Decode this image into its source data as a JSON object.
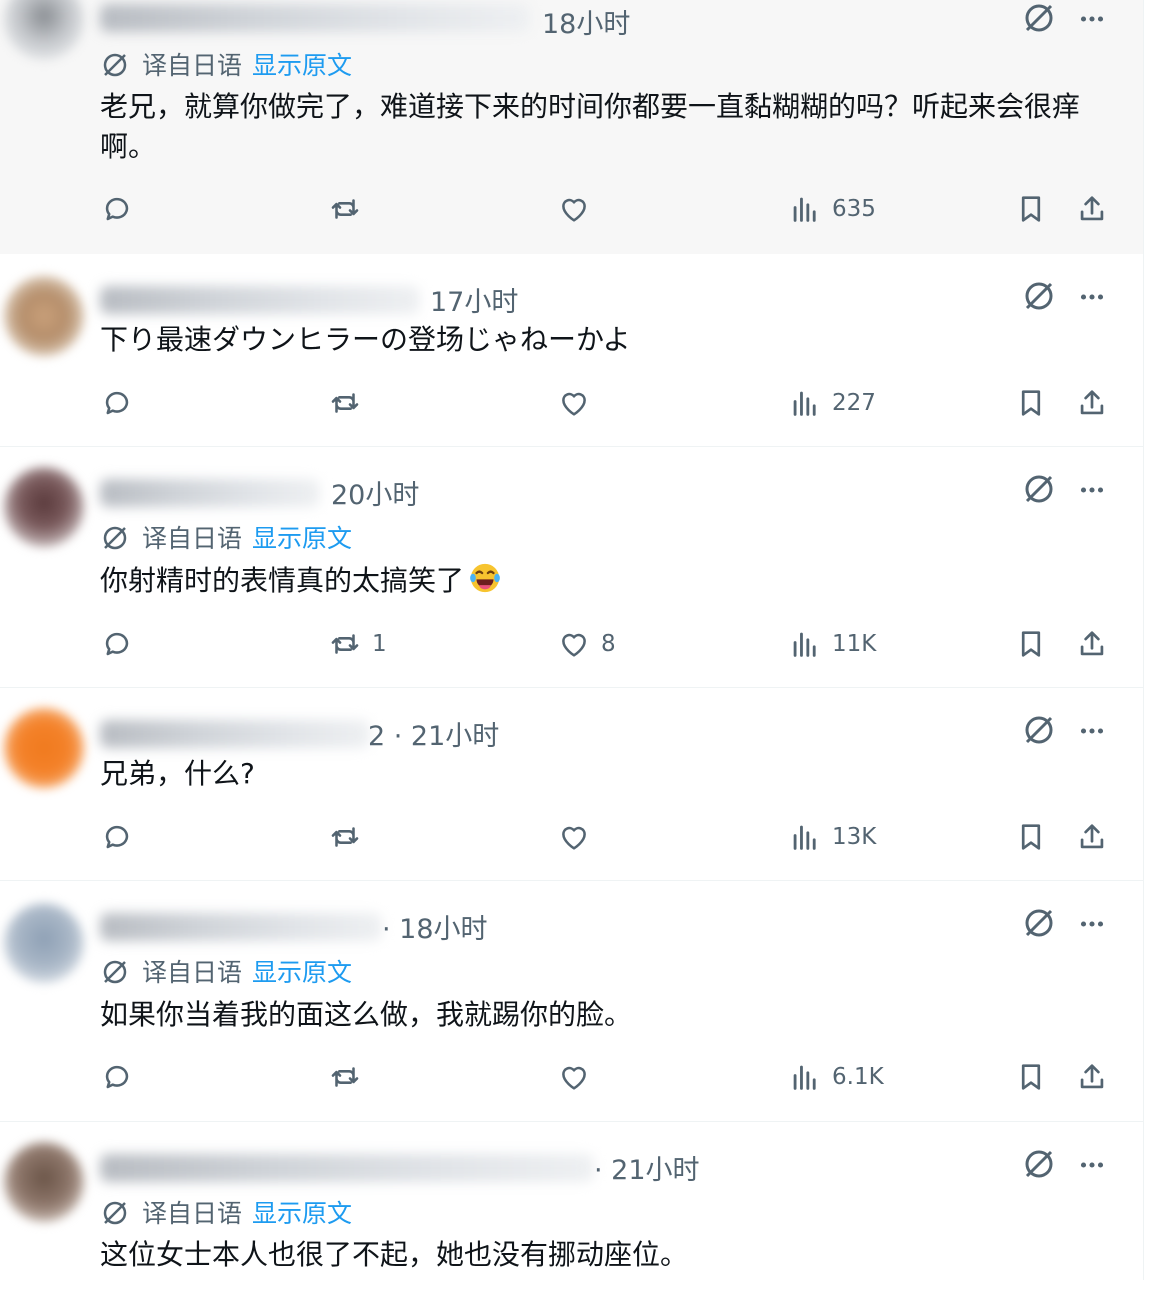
{
  "icons": {
    "reply": "reply-bubble-icon",
    "retweet": "retweet-icon",
    "like": "heart-icon",
    "views": "views-chart-icon",
    "bookmark": "bookmark-icon",
    "share": "share-upload-icon",
    "grok": "grok-slash-circle-icon",
    "more": "more-dots-icon",
    "translate": "translate-icon"
  },
  "colors": {
    "text": "#0f1419",
    "muted": "#536471",
    "link": "#1d9bf0",
    "divider": "#eff3f4",
    "highlight_bg": "#f7f7f7"
  },
  "translate_label": "译自日语",
  "show_original_label": "显示原文",
  "posts": [
    {
      "time": "18小时",
      "translated": true,
      "text": "老兄，就算你做完了，难道接下来的时间你都要一直黏糊糊的吗？听起来会很痒啊。",
      "replies": "",
      "reposts": "",
      "likes": "",
      "views": "635"
    },
    {
      "time": "17小时",
      "translated": false,
      "text": "下り最速ダウンヒラーの登场じゃねーかよ",
      "replies": "",
      "reposts": "",
      "likes": "",
      "views": "227"
    },
    {
      "time": "20小时",
      "translated": true,
      "text": "你射精时的表情真的太搞笑了",
      "emoji": "tears-of-joy-emoji",
      "replies": "",
      "reposts": "1",
      "likes": "8",
      "views": "11K"
    },
    {
      "time": "2 · 21小时",
      "translated": false,
      "text": "兄弟，什么?",
      "replies": "",
      "reposts": "",
      "likes": "",
      "views": "13K"
    },
    {
      "time": "· 18小时",
      "translated": true,
      "text": "如果你当着我的面这么做，我就踢你的脸。",
      "replies": "",
      "reposts": "",
      "likes": "",
      "views": "6.1K"
    },
    {
      "time": "· 21小时",
      "translated": true,
      "text": "这位女士本人也很了不起，她也没有挪动座位。",
      "replies": "",
      "reposts": "",
      "likes": "",
      "views": ""
    }
  ]
}
